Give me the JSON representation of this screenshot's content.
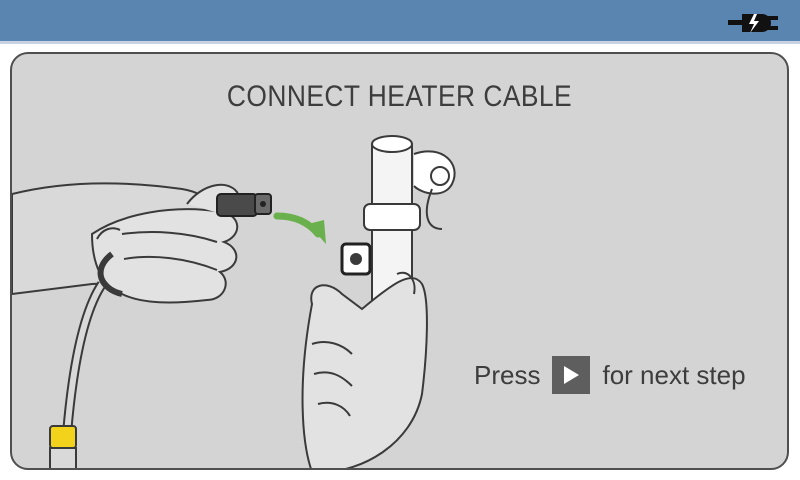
{
  "header": {
    "icon": "power-plug-icon"
  },
  "panel": {
    "title": "CONNECT HEATER CABLE",
    "illustration": "hands-connecting-heater-cable-to-tube",
    "instruction_prefix": "Press",
    "instruction_button_icon": "play-icon",
    "instruction_suffix": "for next step"
  },
  "colors": {
    "header_bar": "#5b85b1",
    "panel_bg": "#d4d4d4",
    "arrow": "#6ab04c",
    "tube": "#5c96d8",
    "cable_band": "#f2d21b",
    "button": "#5e5e5e"
  }
}
